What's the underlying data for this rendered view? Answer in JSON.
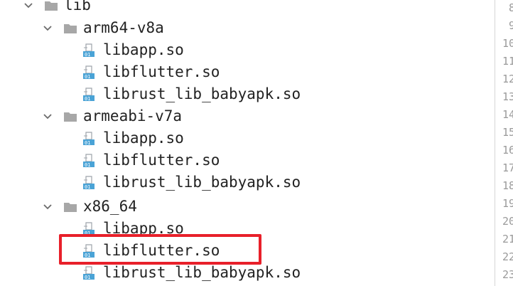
{
  "tree": {
    "root_folder": {
      "label": "lib"
    },
    "groups": [
      {
        "label": "arm64-v8a",
        "files": [
          "libapp.so",
          "libflutter.so",
          "librust_lib_babyapk.so"
        ]
      },
      {
        "label": "armeabi-v7a",
        "files": [
          "libapp.so",
          "libflutter.so",
          "librust_lib_babyapk.so"
        ]
      },
      {
        "label": "x86_64",
        "files": [
          "libapp.so",
          "libflutter.so",
          "librust_lib_babyapk.so"
        ]
      }
    ],
    "highlighted": {
      "group": "x86_64",
      "file": "libflutter.so"
    }
  },
  "gutter": {
    "line_numbers": [
      "8",
      "9",
      "10",
      "11",
      "12",
      "13",
      "14",
      "15",
      "16",
      "17",
      "18",
      "19",
      "20",
      "21",
      "22",
      "23"
    ]
  },
  "colors": {
    "highlight_border": "#e8202a",
    "folder": "#a7a7a7",
    "file_icon_grey": "#9ea4ab",
    "file_icon_blue": "#4aa3d6",
    "chevron": "#6b6b6b"
  }
}
